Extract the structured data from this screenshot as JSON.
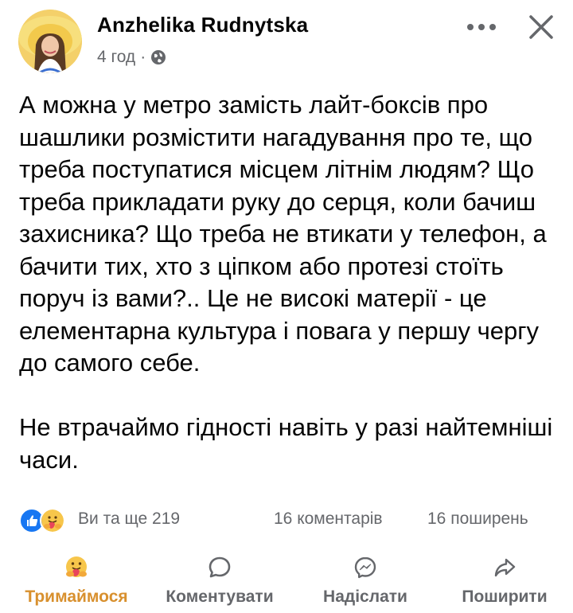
{
  "post": {
    "author": "Anzhelika Rudnytska",
    "time": "4 год",
    "separator": "·",
    "paragraphs": [
      "А можна у метро замість лайт-боксів про шашлики розмістити нагадування про те, що треба поступатися місцем літнім людям? Що треба прикладати руку до серця, коли бачиш захисника? Що треба не втикати у телефон, а бачити тих, хто з ціпком або протезі стоїть поруч із вами?.. Це не високі матерії - це елементарна культура і повага у першу чергу до самого себе.",
      "Не втрачаймо гідності навіть у разі найтемніші часи."
    ]
  },
  "stats": {
    "reactions_text": "Ви та ще 219",
    "comments": "16 коментарів",
    "shares": "16 поширень"
  },
  "actions": {
    "react_label": "Тримаймося",
    "comment_label": "Коментувати",
    "send_label": "Надіслати",
    "share_label": "Поширити"
  },
  "colors": {
    "text": "#050505",
    "secondary": "#65676b",
    "like_blue": "#1877f2",
    "care_yellow": "#d8902e"
  },
  "icons": {
    "globe": "globe-icon",
    "more": "more-dots-icon",
    "close": "close-icon",
    "like": "like-reaction-icon",
    "care": "care-reaction-icon",
    "comment": "comment-bubble-icon",
    "send": "messenger-icon",
    "share": "share-arrow-icon"
  }
}
